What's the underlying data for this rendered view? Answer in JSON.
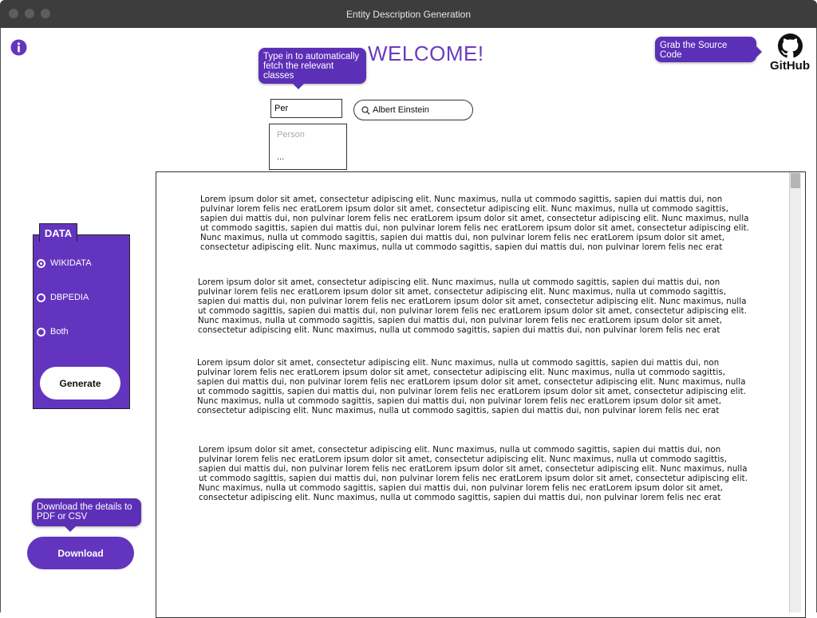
{
  "window": {
    "title": "Entity Description Generation"
  },
  "header": {
    "welcome": "WELCOME!",
    "class_tooltip": "Type in to automatically fetch the relevant classes",
    "source_tooltip": "Grab the Source Code",
    "github_label": "GitHub"
  },
  "class_search": {
    "value": "Per",
    "dropdown": [
      "Person",
      "..."
    ]
  },
  "entity_search": {
    "value": "Albert Einstein"
  },
  "data_panel": {
    "title": "DATA",
    "options": [
      {
        "label": "WIKIDATA",
        "checked": true
      },
      {
        "label": "DBPEDIA",
        "checked": false
      },
      {
        "label": "Both",
        "checked": false
      }
    ],
    "generate_label": "Generate"
  },
  "download": {
    "tooltip": "Download the details to PDF or  CSV",
    "label": "Download"
  },
  "paragraphs": [
    "Lorem ipsum dolor sit amet, consectetur adipiscing elit. Nunc maximus, nulla ut commodo sagittis, sapien dui mattis dui, non pulvinar lorem felis nec eratLorem ipsum dolor sit amet, consectetur adipiscing elit. Nunc maximus, nulla ut commodo sagittis, sapien dui mattis dui, non pulvinar lorem felis nec eratLorem ipsum dolor sit amet, consectetur adipiscing elit. Nunc maximus, nulla ut commodo sagittis, sapien dui mattis dui, non pulvinar lorem felis nec eratLorem ipsum dolor sit amet, consectetur adipiscing elit. Nunc maximus, nulla ut commodo sagittis, sapien dui mattis dui, non pulvinar lorem felis nec eratLorem ipsum dolor sit amet, consectetur adipiscing elit. Nunc maximus, nulla ut commodo sagittis, sapien dui mattis dui, non pulvinar lorem felis nec erat",
    "Lorem ipsum dolor sit amet, consectetur adipiscing elit. Nunc maximus, nulla ut commodo sagittis, sapien dui mattis dui, non pulvinar lorem felis nec eratLorem ipsum dolor sit amet, consectetur adipiscing elit. Nunc maximus, nulla ut commodo sagittis, sapien dui mattis dui, non pulvinar lorem felis nec eratLorem ipsum dolor sit amet, consectetur adipiscing elit. Nunc maximus, nulla ut commodo sagittis, sapien dui mattis dui, non pulvinar lorem felis nec eratLorem ipsum dolor sit amet, consectetur adipiscing elit. Nunc maximus, nulla ut commodo sagittis, sapien dui mattis dui, non pulvinar lorem felis nec eratLorem ipsum dolor sit amet, consectetur adipiscing elit. Nunc maximus, nulla ut commodo sagittis, sapien dui mattis dui, non pulvinar lorem felis nec erat",
    "Lorem ipsum dolor sit amet, consectetur adipiscing elit. Nunc maximus, nulla ut commodo sagittis, sapien dui mattis dui, non pulvinar lorem felis nec eratLorem ipsum dolor sit amet, consectetur adipiscing elit. Nunc maximus, nulla ut commodo sagittis, sapien dui mattis dui, non pulvinar lorem felis nec eratLorem ipsum dolor sit amet, consectetur adipiscing elit. Nunc maximus, nulla ut commodo sagittis, sapien dui mattis dui, non pulvinar lorem felis nec eratLorem ipsum dolor sit amet, consectetur adipiscing elit. Nunc maximus, nulla ut commodo sagittis, sapien dui mattis dui, non pulvinar lorem felis nec eratLorem ipsum dolor sit amet, consectetur adipiscing elit. Nunc maximus, nulla ut commodo sagittis, sapien dui mattis dui, non pulvinar lorem felis nec erat",
    "Lorem ipsum dolor sit amet, consectetur adipiscing elit. Nunc maximus, nulla ut commodo sagittis, sapien dui mattis dui, non pulvinar lorem felis nec eratLorem ipsum dolor sit amet, consectetur adipiscing elit. Nunc maximus, nulla ut commodo sagittis, sapien dui mattis dui, non pulvinar lorem felis nec eratLorem ipsum dolor sit amet, consectetur adipiscing elit. Nunc maximus, nulla ut commodo sagittis, sapien dui mattis dui, non pulvinar lorem felis nec eratLorem ipsum dolor sit amet, consectetur adipiscing elit. Nunc maximus, nulla ut commodo sagittis, sapien dui mattis dui, non pulvinar lorem felis nec eratLorem ipsum dolor sit amet, consectetur adipiscing elit. Nunc maximus, nulla ut commodo sagittis, sapien dui mattis dui, non pulvinar lorem felis nec erat"
  ],
  "colors": {
    "accent": "#6335bf",
    "titlebar": "#3d3d3d"
  },
  "icons": [
    "info-icon",
    "github-icon",
    "search-icon"
  ]
}
